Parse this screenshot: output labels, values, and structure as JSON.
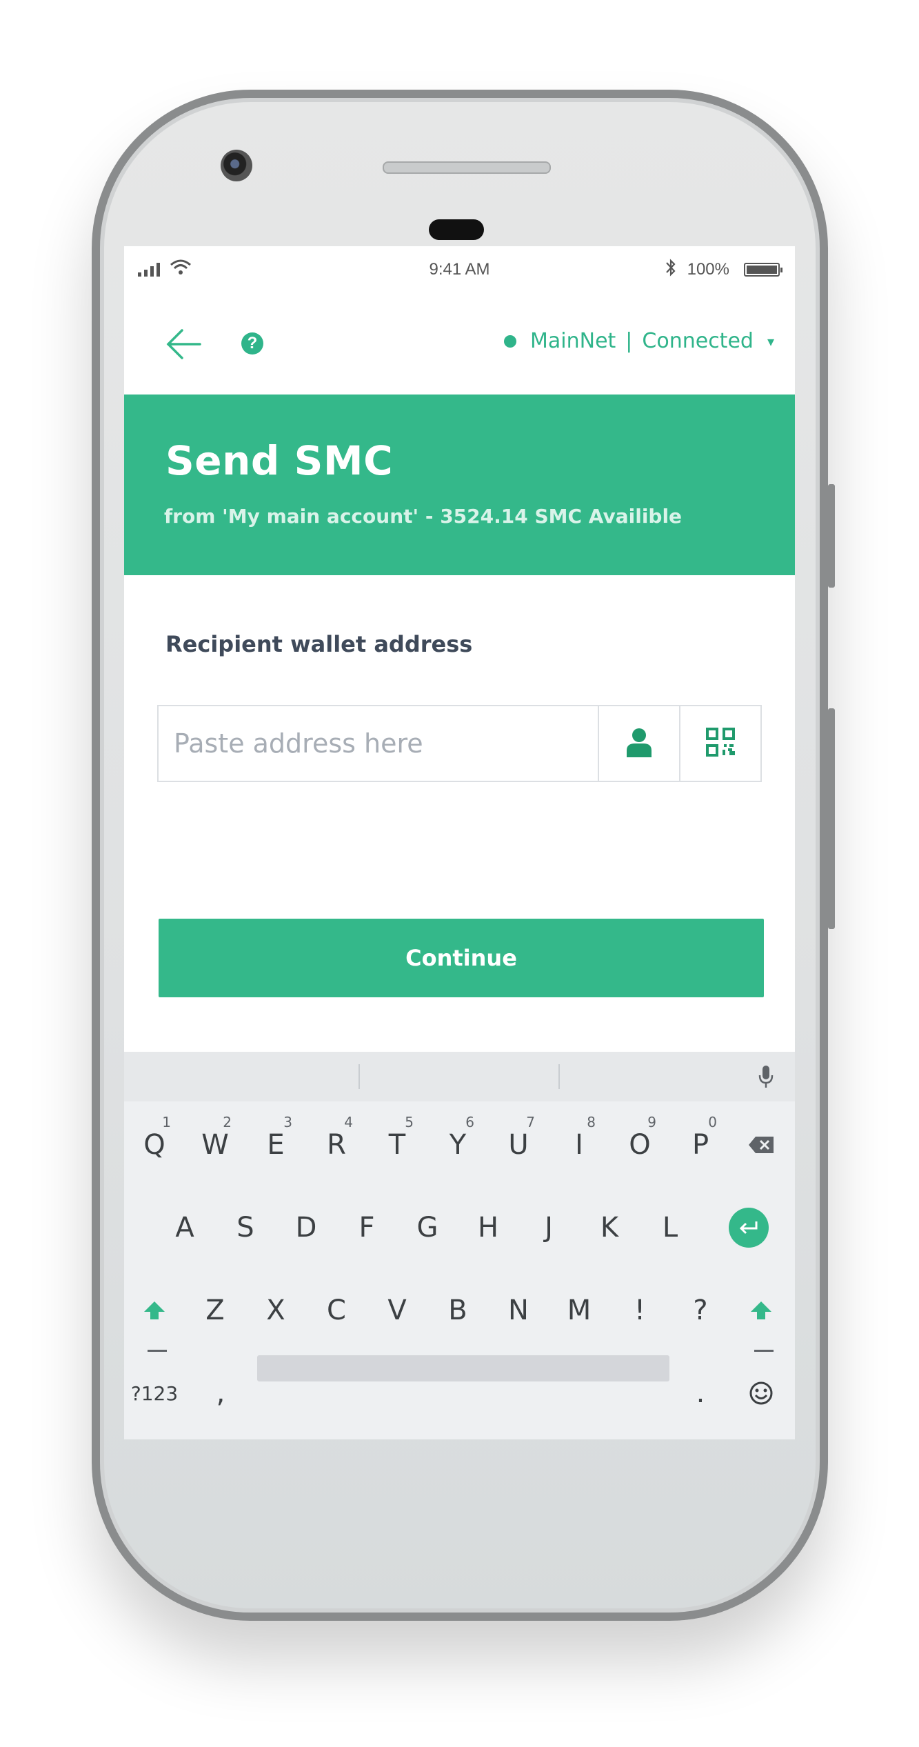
{
  "status_bar": {
    "time": "9:41 AM",
    "battery_pct": "100%"
  },
  "network": {
    "name": "MainNet",
    "separator": "|",
    "state": "Connected",
    "caret": "▾"
  },
  "header": {
    "help": "?"
  },
  "hero": {
    "title": "Send SMC",
    "subtitle": "from 'My main account' - 3524.14 SMC Availible"
  },
  "form": {
    "label": "Recipient wallet address",
    "placeholder": "Paste address here",
    "continue": "Continue"
  },
  "keyboard": {
    "row1": [
      {
        "k": "Q",
        "n": "1"
      },
      {
        "k": "W",
        "n": "2"
      },
      {
        "k": "E",
        "n": "3"
      },
      {
        "k": "R",
        "n": "4"
      },
      {
        "k": "T",
        "n": "5"
      },
      {
        "k": "Y",
        "n": "6"
      },
      {
        "k": "U",
        "n": "7"
      },
      {
        "k": "I",
        "n": "8"
      },
      {
        "k": "O",
        "n": "9"
      },
      {
        "k": "P",
        "n": "0"
      }
    ],
    "row2": [
      "A",
      "S",
      "D",
      "F",
      "G",
      "H",
      "J",
      "K",
      "L"
    ],
    "row3": [
      "Z",
      "X",
      "C",
      "V",
      "B",
      "N",
      "M",
      "!",
      "?"
    ],
    "row4": {
      "symbols": "?123",
      "comma": ",",
      "period": "."
    }
  },
  "colors": {
    "accent": "#34b88a",
    "label": "#3f4a5a",
    "placeholder": "#a7adb5"
  },
  "icons": [
    "back-arrow-icon",
    "help-icon",
    "contact-icon",
    "qr-code-icon",
    "mic-icon",
    "backspace-icon",
    "enter-icon",
    "shift-icon",
    "emoji-icon"
  ]
}
